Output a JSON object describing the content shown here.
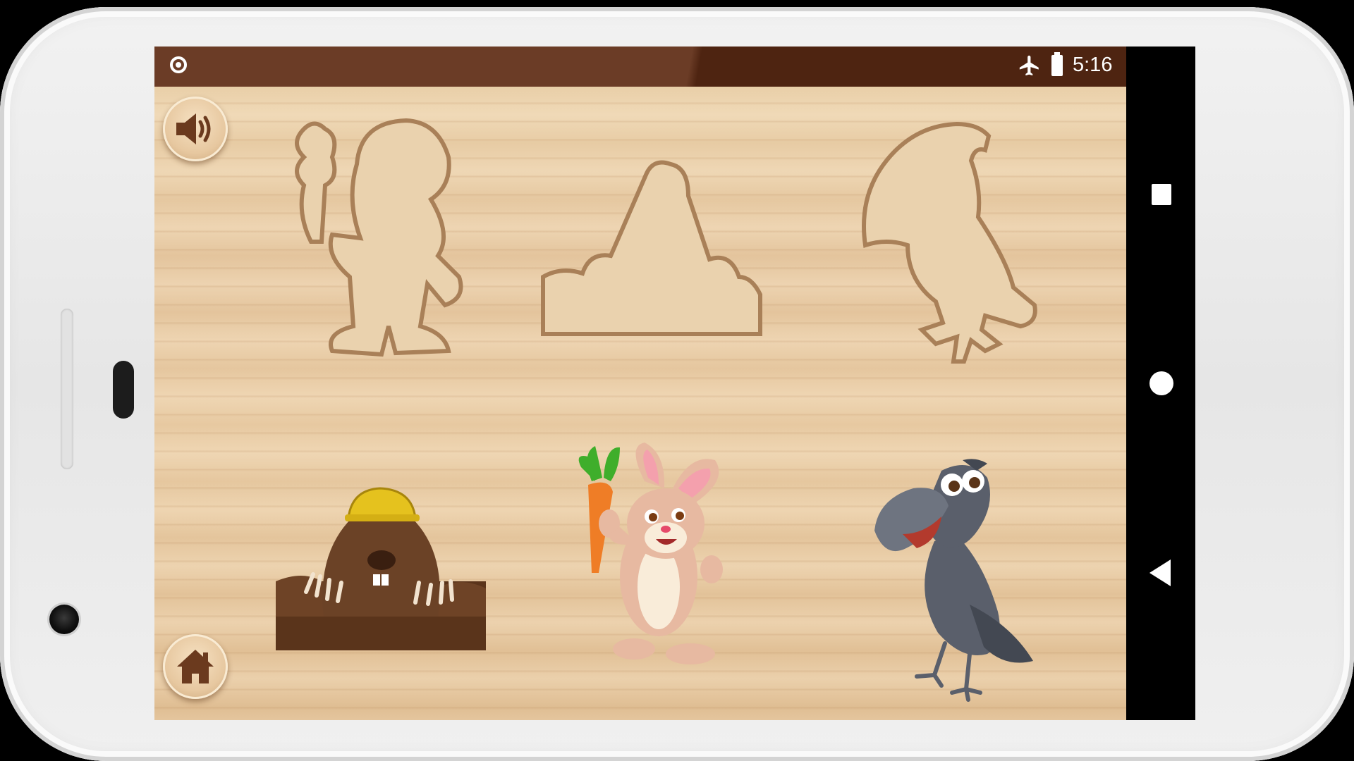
{
  "status_bar": {
    "clock": "5:16",
    "icons": [
      "notification-circle-icon",
      "airplane-mode-icon",
      "battery-icon"
    ]
  },
  "game": {
    "buttons": {
      "sound": "speaker-icon",
      "home": "home-icon"
    },
    "slots": [
      {
        "name": "rabbit-silhouette-slot"
      },
      {
        "name": "mole-hill-silhouette-slot"
      },
      {
        "name": "crow-silhouette-slot"
      }
    ],
    "pieces": [
      {
        "name": "mole-piece"
      },
      {
        "name": "rabbit-piece"
      },
      {
        "name": "crow-piece"
      }
    ]
  },
  "nav_bar": {
    "icons": [
      "recents-square-icon",
      "home-circle-icon",
      "back-triangle-icon"
    ]
  },
  "colors": {
    "status_bar": "#6b3c26",
    "wood": "#e6c79e",
    "slot_shadow": "#b78e64"
  }
}
